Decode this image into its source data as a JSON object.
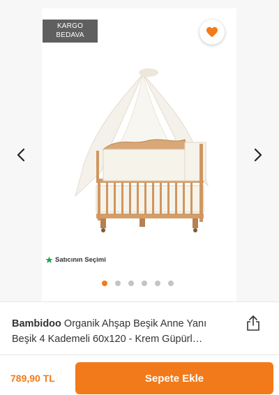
{
  "gallery": {
    "badge": {
      "line1": "KARGO",
      "line2": "BEDAVA"
    },
    "seller_choice": "Satıcının Seçimi",
    "image_count": 6,
    "active_index": 0
  },
  "product": {
    "brand": "Bambidoo",
    "name": "Organik Ahşap Beşik Anne Yanı Beşik 4 Kademeli 60x120 - Krem Güpürl…"
  },
  "bottom_bar": {
    "price": "789,90 TL",
    "add_to_cart_label": "Sepete Ekle"
  },
  "colors": {
    "accent": "#f27a1a",
    "star": "#1aa64b",
    "badge_bg": "#5f5f5f"
  },
  "icons": [
    "heart-icon",
    "chevron-left-icon",
    "chevron-right-icon",
    "star-icon",
    "share-icon"
  ]
}
